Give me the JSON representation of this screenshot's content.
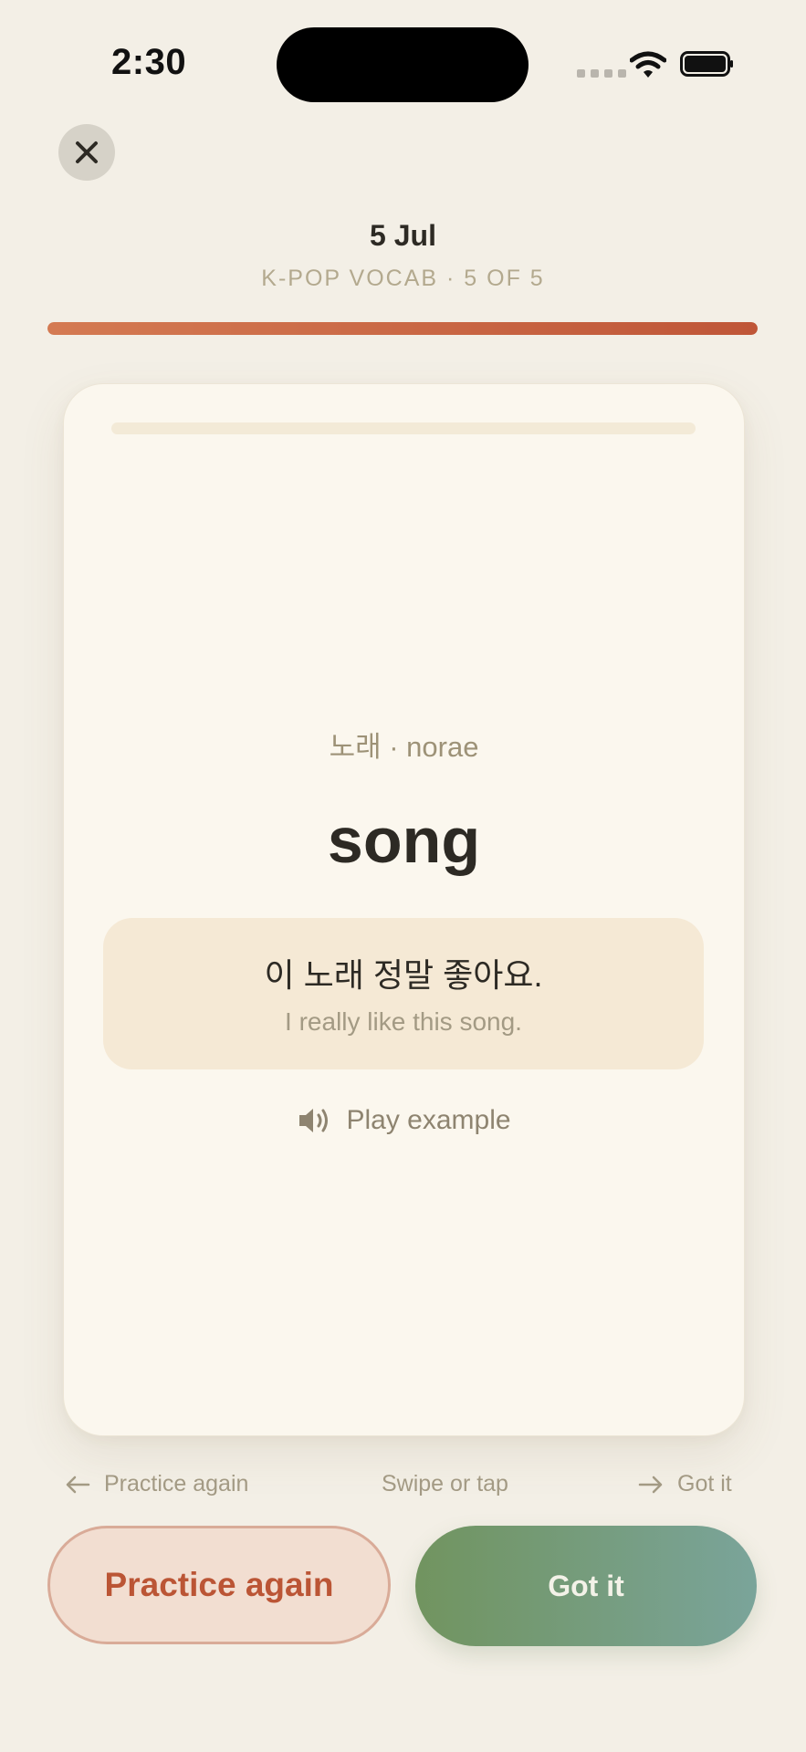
{
  "status_bar": {
    "time": "2:30"
  },
  "header": {
    "close_icon": "close-icon",
    "date": "5 Jul",
    "subtitle": "K-POP VOCAB · 5 OF 5",
    "progress": 1.0,
    "progress_color": "#c95d3e"
  },
  "card": {
    "romanization": "노래 · norae",
    "word": "song",
    "example": {
      "korean": "이 노래 정말 좋아요.",
      "english": "I really like this song."
    },
    "play_label": "Play example",
    "play_icon": "speaker-icon"
  },
  "hints": {
    "left": "Practice again",
    "center": "Swipe or tap",
    "right": "Got it"
  },
  "buttons": {
    "practice_again": "Practice again",
    "got_it": "Got it"
  },
  "colors": {
    "background": "#f3efe6",
    "accent_orange": "#c95d3e",
    "accent_green": "#71945f"
  }
}
